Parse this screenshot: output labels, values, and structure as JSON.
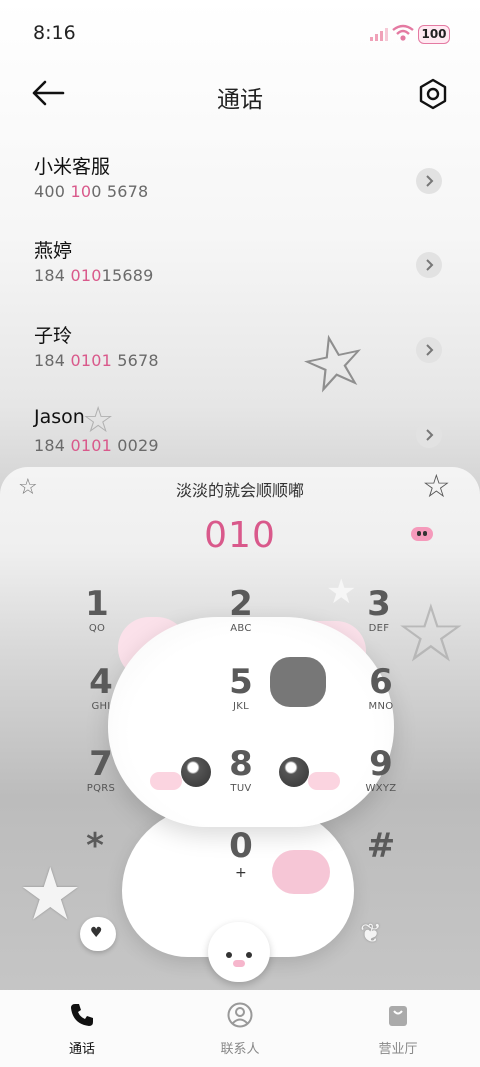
{
  "status": {
    "time": "8:16",
    "battery": "100"
  },
  "header": {
    "title": "通话"
  },
  "calls": [
    {
      "name": "小米客服",
      "number_parts": [
        "400 ",
        "10",
        "0 5678"
      ]
    },
    {
      "name": "燕婷",
      "number_parts": [
        "184 ",
        "010",
        "15689"
      ]
    },
    {
      "name": "子玲",
      "number_parts": [
        "184 ",
        "0101",
        " 5678"
      ]
    },
    {
      "name": "Jason",
      "number_parts": [
        "184 ",
        "0101",
        " 0029"
      ]
    }
  ],
  "dialer": {
    "motto": "淡淡的就会顺顺嘟",
    "dialed": "010",
    "keys": [
      {
        "digit": "1",
        "letters": "QO"
      },
      {
        "digit": "2",
        "letters": "ABC"
      },
      {
        "digit": "3",
        "letters": "DEF"
      },
      {
        "digit": "4",
        "letters": "GHI"
      },
      {
        "digit": "5",
        "letters": "JKL"
      },
      {
        "digit": "6",
        "letters": "MNO"
      },
      {
        "digit": "7",
        "letters": "PQRS"
      },
      {
        "digit": "8",
        "letters": "TUV"
      },
      {
        "digit": "9",
        "letters": "WXYZ"
      },
      {
        "digit": "*",
        "letters": ""
      },
      {
        "digit": "0",
        "letters": "+"
      },
      {
        "digit": "#",
        "letters": ""
      }
    ]
  },
  "nav": {
    "tabs": [
      {
        "label": "通话",
        "active": true
      },
      {
        "label": "联系人",
        "active": false
      },
      {
        "label": "营业厅",
        "active": false
      }
    ]
  },
  "colors": {
    "accent": "#d9598b",
    "text": "#222222",
    "muted": "#6a6a6a"
  }
}
